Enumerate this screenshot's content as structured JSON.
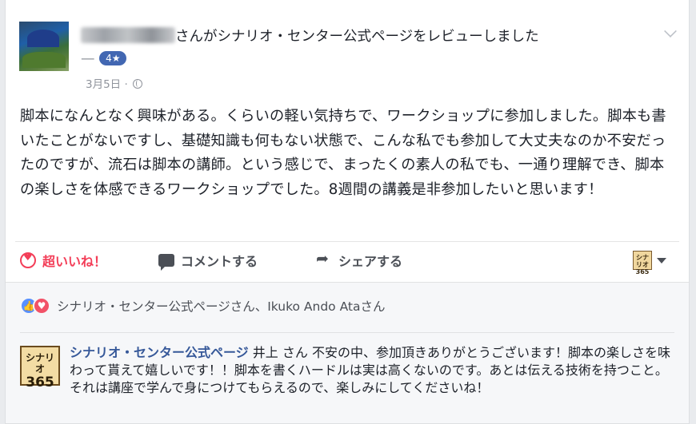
{
  "post": {
    "author_suffix": "さんがシナリオ・センター公式ページをレビューしました",
    "dash": "—",
    "rating_badge": "4★",
    "date": "3月5日",
    "separator": "·",
    "body": "脚本になんとなく興味がある。くらいの軽い気持ちで、ワークショップに参加しました。脚本も書いたことがないですし、基礎知識も何もない状態で、こんな私でも参加して大丈夫なのか不安だったのですが、流石は脚本の講師。という感じで、まったくの素人の私でも、一通り理解でき、脚本の楽しさを体感できるワークショップでした。8週間の講義是非参加したいと思います！"
  },
  "actions": {
    "love_label": "超いいね！",
    "comment_label": "コメントする",
    "share_label": "シェアする",
    "page_logo_line1": "シナリオ",
    "page_logo_line2": "365"
  },
  "reactions": {
    "names": "シナリオ・センター公式ページさん、Ikuko Ando Ataさん"
  },
  "comment": {
    "avatar_line1": "シナリオ",
    "avatar_line2": "365",
    "author": "シナリオ・センター公式ページ",
    "text": " 井上 さん 不安の中、参加頂きありがとうございます！脚本の楽しさを味わって貰えて嬉しいです！！脚本を書くハードルは実は高くないのです。あとは伝える技術を持つこと。それは講座で学んで身につけてもらえるので、楽しみにしてくださいね！"
  },
  "colors": {
    "link": "#365899",
    "love": "#f33e58",
    "like": "#5890ff",
    "badge": "#4267b2"
  },
  "icons": [
    "chevron-down-icon",
    "globe-icon",
    "heart-icon",
    "comment-icon",
    "share-icon",
    "caret-down-icon",
    "like-reaction-icon",
    "love-reaction-icon"
  ]
}
